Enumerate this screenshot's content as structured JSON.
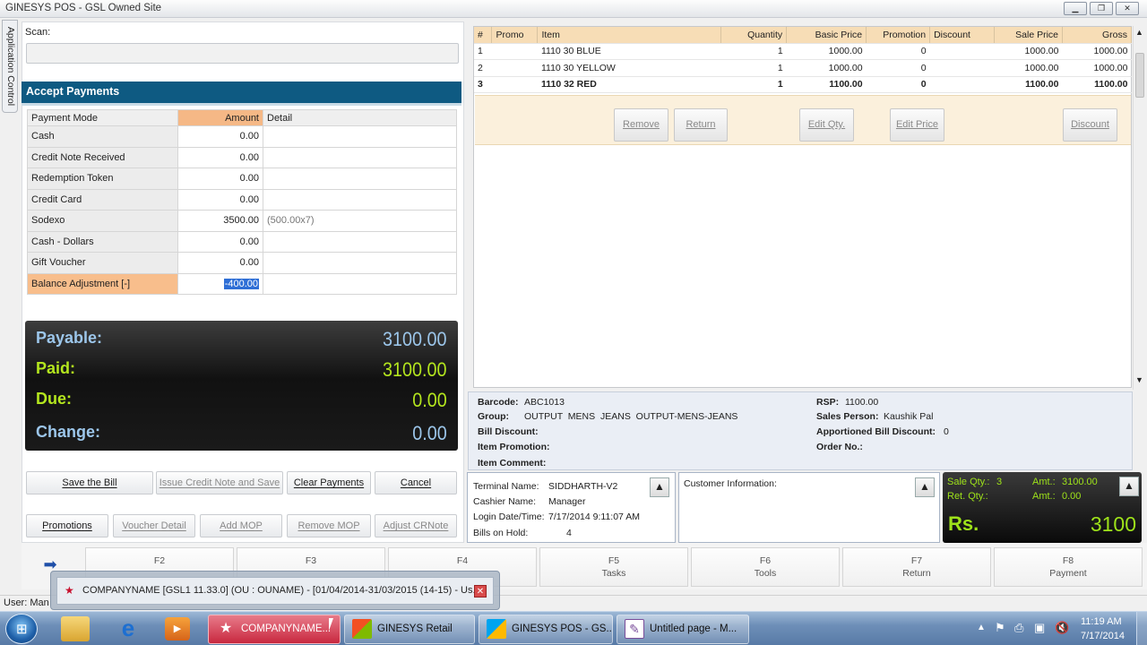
{
  "window": {
    "title": "GINESYS POS - GSL Owned Site"
  },
  "side_tab": {
    "label": "Application Control"
  },
  "scan": {
    "label": "Scan:",
    "value": ""
  },
  "accept_payments": {
    "title": "Accept Payments",
    "headers": {
      "mode": "Payment Mode",
      "amount": "Amount",
      "detail": "Detail"
    },
    "rows": [
      {
        "mode": "Cash",
        "amount": "0.00",
        "detail": ""
      },
      {
        "mode": "Credit Note Received",
        "amount": "0.00",
        "detail": ""
      },
      {
        "mode": "Redemption Token",
        "amount": "0.00",
        "detail": ""
      },
      {
        "mode": "Credit Card",
        "amount": "0.00",
        "detail": ""
      },
      {
        "mode": "Sodexo",
        "amount": "3500.00",
        "detail": "(500.00x7)"
      },
      {
        "mode": "Cash - Dollars",
        "amount": "0.00",
        "detail": ""
      },
      {
        "mode": "Gift Voucher",
        "amount": "0.00",
        "detail": ""
      },
      {
        "mode": "Balance Adjustment [-]",
        "amount": "-400.00",
        "detail": ""
      }
    ]
  },
  "totals": {
    "payable_label": "Payable:",
    "payable": "3100.00",
    "paid_label": "Paid:",
    "paid": "3100.00",
    "due_label": "Due:",
    "due": "0.00",
    "change_label": "Change:",
    "change": "0.00",
    "colors": {
      "payable": "#9cc6ea",
      "paid": "#b4e61e",
      "due": "#b4e61e",
      "change": "#9cc6ea"
    }
  },
  "payment_buttons": {
    "save": "Save the Bill",
    "issue_cn": "Issue Credit Note and Save",
    "clear": "Clear Payments",
    "cancel": "Cancel",
    "promotions": "Promotions",
    "voucher_detail": "Voucher Detail",
    "add_mop": "Add MOP",
    "remove_mop": "Remove MOP",
    "adjust_crnote": "Adjust CRNote"
  },
  "items": {
    "headers": [
      "#",
      "Promo",
      "Item",
      "Quantity",
      "Basic Price",
      "Promotion",
      "Discount",
      "Sale Price",
      "Gross"
    ],
    "rows": [
      {
        "n": "1",
        "promo": "",
        "item": "1110 30 BLUE",
        "qty": "1",
        "basic": "1000.00",
        "promotion": "0",
        "discount": "",
        "sale": "1000.00",
        "gross": "1000.00"
      },
      {
        "n": "2",
        "promo": "",
        "item": "1110 30 YELLOW",
        "qty": "1",
        "basic": "1000.00",
        "promotion": "0",
        "discount": "",
        "sale": "1000.00",
        "gross": "1000.00"
      },
      {
        "n": "3",
        "promo": "",
        "item": "1110 32 RED",
        "qty": "1",
        "basic": "1100.00",
        "promotion": "0",
        "discount": "",
        "sale": "1100.00",
        "gross": "1100.00"
      }
    ],
    "buttons": {
      "remove": "Remove",
      "return": "Return",
      "edit_qty": "Edit Qty.",
      "edit_price": "Edit Price",
      "discount": "Discount"
    }
  },
  "item_info": {
    "barcode_l": "Barcode:",
    "barcode": "ABC1013",
    "group_l": "Group:",
    "group": "OUTPUT  MENS  JEANS  OUTPUT-MENS-JEANS",
    "bill_discount_l": "Bill Discount:",
    "item_promotion_l": "Item Promotion:",
    "item_comment_l": "Item Comment:",
    "rsp_l": "RSP:",
    "rsp": "1100.00",
    "sales_person_l": "Sales Person:",
    "sales_person": "Kaushik Pal",
    "apportioned_l": "Apportioned Bill Discount:",
    "apportioned": "0",
    "order_no_l": "Order No.:"
  },
  "terminal": {
    "terminal_l": "Terminal Name:",
    "terminal": "SIDDHARTH-V2",
    "cashier_l": "Cashier Name:",
    "cashier": "Manager",
    "login_l": "Login Date/Time:",
    "login": "7/17/2014 9:11:07 AM",
    "hold_l": "Bills on Hold:",
    "hold": "4"
  },
  "customer": {
    "label": "Customer Information:"
  },
  "summary": {
    "sale_qty_l": "Sale Qty.:",
    "sale_qty": "3",
    "amt1_l": "Amt.:",
    "amt1": "3100.00",
    "ret_qty_l": "Ret. Qty.:",
    "ret_qty": "",
    "amt2_l": "Amt.:",
    "amt2": "0.00",
    "rs_l": "Rs.",
    "rs": "3100"
  },
  "fkeys": [
    {
      "key": "F2",
      "label": ""
    },
    {
      "key": "F3",
      "label": ""
    },
    {
      "key": "F4",
      "label": ""
    },
    {
      "key": "F5",
      "label": "Tasks"
    },
    {
      "key": "F6",
      "label": "Tools"
    },
    {
      "key": "F7",
      "label": "Return"
    },
    {
      "key": "F8",
      "label": "Payment"
    }
  ],
  "statusbar": {
    "user": "User: Man"
  },
  "popup": {
    "text": "COMPANYNAME [GSL1 11.33.0] (OU : OUNAME) - [01/04/2014-31/03/2015 (14-15)  - Us..."
  },
  "taskbar": {
    "items": [
      "COMPANYNAME...",
      "GINESYS Retail",
      "GINESYS POS - GS...",
      "Untitled page - M..."
    ],
    "time": "11:19 AM",
    "date": "7/17/2014"
  }
}
